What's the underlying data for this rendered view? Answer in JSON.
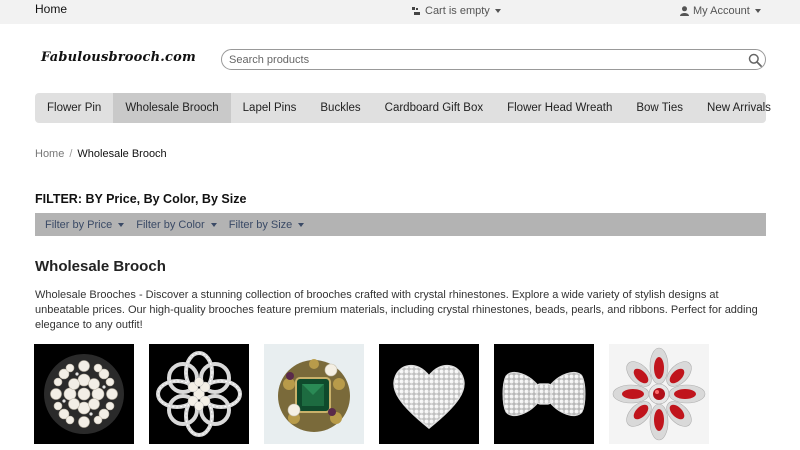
{
  "topbar": {
    "home_label": "Home",
    "cart_label": "Cart is empty",
    "account_label": "My Account"
  },
  "logo": {
    "text": "Fabulousbrooch.com"
  },
  "search": {
    "placeholder": "Search products",
    "value": ""
  },
  "nav": {
    "items": [
      {
        "label": "Flower Pin"
      },
      {
        "label": "Wholesale Brooch"
      },
      {
        "label": "Lapel Pins"
      },
      {
        "label": "Buckles"
      },
      {
        "label": "Cardboard Gift Box"
      },
      {
        "label": "Flower Head Wreath"
      },
      {
        "label": "Bow Ties"
      },
      {
        "label": "New Arrivals"
      }
    ],
    "active": "Wholesale Brooch"
  },
  "breadcrumb": {
    "home": "Home",
    "separator": "/",
    "current": "Wholesale Brooch"
  },
  "filter": {
    "title": "FILTER: BY Price, By Color, By Size",
    "options": [
      {
        "label": "Filter by Price"
      },
      {
        "label": "Filter by Color"
      },
      {
        "label": "Filter by Size"
      }
    ]
  },
  "category": {
    "title": "Wholesale Brooch",
    "description": "Wholesale Brooches - Discover a stunning collection of brooches crafted with crystal rhinestones. Explore a wide variety of stylish designs at unbeatable prices. Our high-quality brooches feature premium materials, including crystal rhinestones, beads, pearls, and ribbons. Perfect for adding elegance to any outfit!"
  },
  "products": [
    {
      "image": "pearl-cluster-brooch-image",
      "bg": "#000000"
    },
    {
      "image": "pearl-flower-brooch-image",
      "bg": "#000000"
    },
    {
      "image": "green-stone-brooch-image",
      "bg": "#e8eef0"
    },
    {
      "image": "heart-rhinestone-brooch-image",
      "bg": "#000000"
    },
    {
      "image": "bow-rhinestone-brooch-image",
      "bg": "#000000"
    },
    {
      "image": "red-crystal-brooch-image",
      "bg": "#f4f4f4"
    }
  ],
  "colors": {
    "topbar_bg": "#f2f2f2",
    "nav_bg": "#e0e0e0",
    "nav_active_bg": "#c9c9c9",
    "filterbar_bg": "#b3b3b3",
    "filter_text": "#3a4a66"
  }
}
